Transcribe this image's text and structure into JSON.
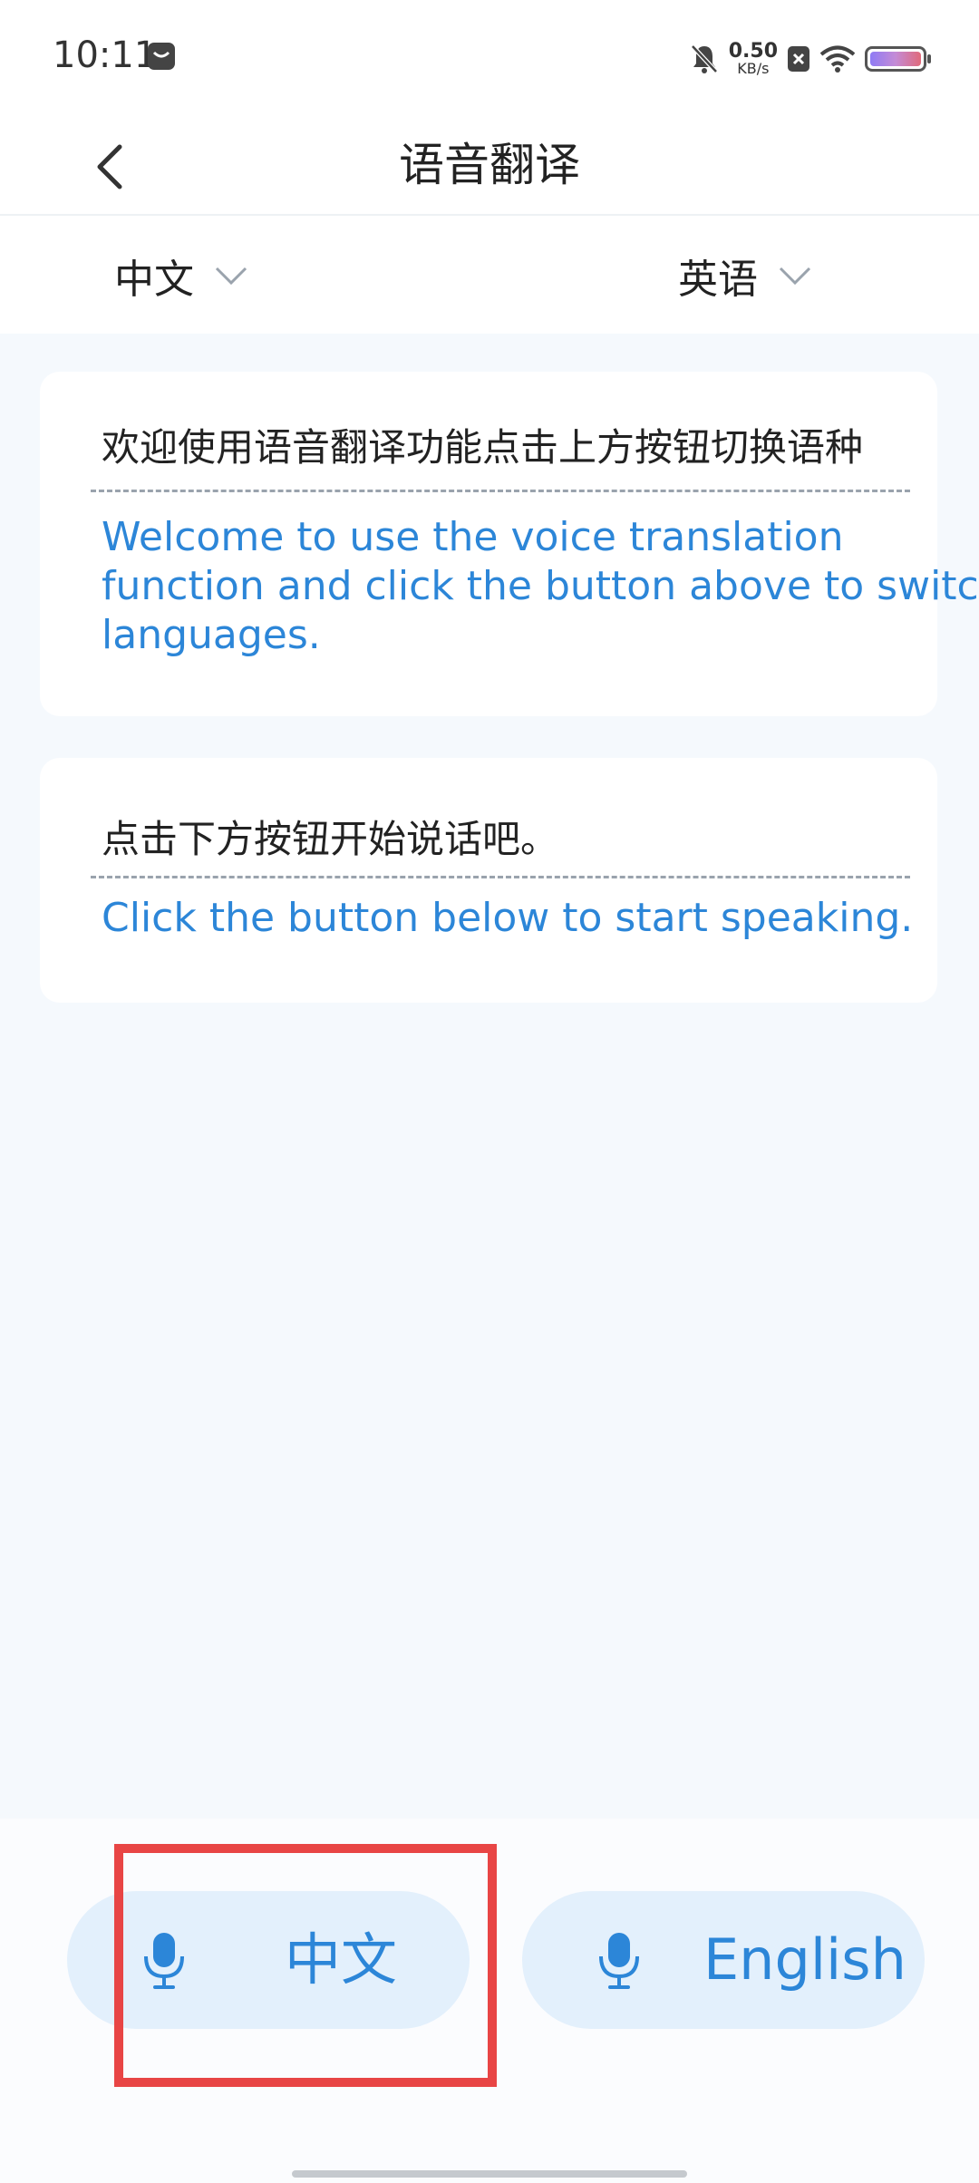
{
  "status_bar": {
    "time": "10:11",
    "net_speed_value": "0.50",
    "net_speed_unit": "KB/s",
    "icons": [
      "notification-icon",
      "bell-mute-icon",
      "data-blocked-icon",
      "wifi-icon",
      "battery-icon"
    ]
  },
  "header": {
    "title": "语音翻译",
    "back_icon": "chevron-left-icon"
  },
  "languages": {
    "source": "中文",
    "target": "英语"
  },
  "messages": [
    {
      "source": "欢迎使用语音翻译功能点击上方按钮切换语种",
      "target": "Welcome to use the voice translation\nfunction and click the button above to switc\nlanguages."
    },
    {
      "source": "点击下方按钮开始说话吧。",
      "target": "Click the button below to start speaking."
    }
  ],
  "buttons": {
    "speak_chinese": "中文",
    "speak_english": "English"
  },
  "colors": {
    "accent": "#2c86d8",
    "button_bg": "#e3f0fc",
    "page_bg": "#f5f9fd",
    "highlight": "#e84545"
  }
}
